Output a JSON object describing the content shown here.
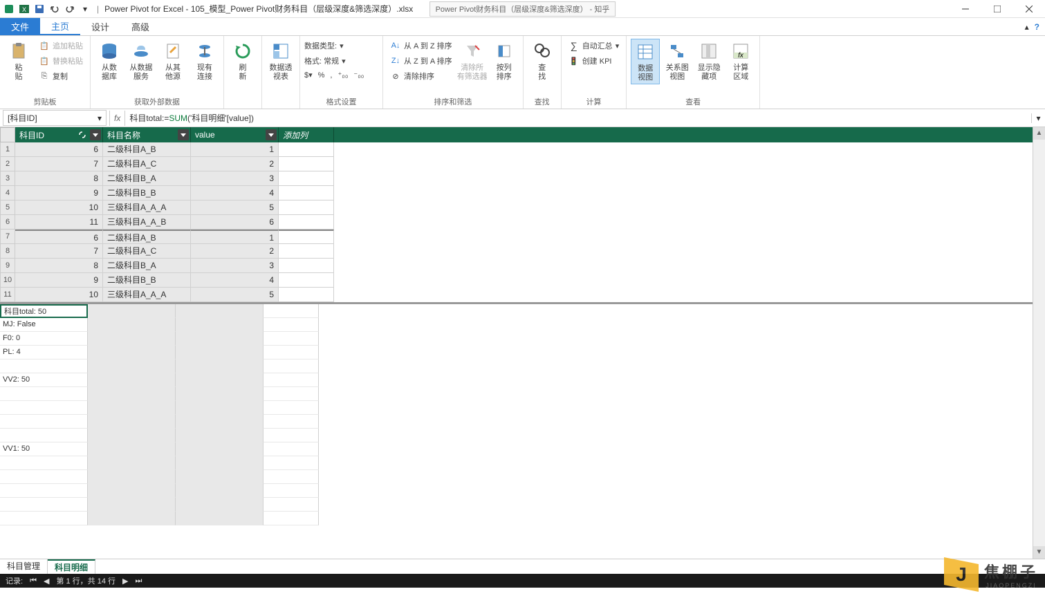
{
  "titlebar": {
    "app_title": "Power Pivot for Excel - 105_模型_Power Pivot财务科目（层级深度&筛选深度）.xlsx",
    "background_tab": "Power Pivot财务科目（层级深度&筛选深度） - 知乎"
  },
  "ribbon_tabs": {
    "file": "文件",
    "home": "主页",
    "design": "设计",
    "advanced": "高级"
  },
  "ribbon": {
    "clipboard": {
      "paste": "粘\n贴",
      "append_paste": "追加粘贴",
      "replace_paste": "替换粘贴",
      "copy": "复制",
      "group_label": "剪贴板"
    },
    "external_data": {
      "from_db": "从数\n据库",
      "from_service": "从数据\n服务",
      "from_other": "从其\n他源",
      "existing_conn": "现有\n连接",
      "group_label": "获取外部数据"
    },
    "refresh": {
      "refresh": "刷\n新"
    },
    "pivot": {
      "pivot_table": "数据透\n视表"
    },
    "format": {
      "data_type": "数据类型:",
      "format": "格式: 常规",
      "group_label": "格式设置"
    },
    "sort": {
      "sort_az": "从 A 到 Z 排序",
      "sort_za": "从 Z 到 A 排序",
      "clear_sort": "清除排序",
      "clear_filter": "清除所\n有筛选器",
      "sort_by_col": "按列\n排序",
      "group_label": "排序和筛选"
    },
    "find": {
      "find": "查\n找",
      "group_label": "查找"
    },
    "calc": {
      "autosum": "自动汇总",
      "create_kpi": "创建 KPI",
      "group_label": "计算"
    },
    "view": {
      "data_view": "数据\n视图",
      "diagram_view": "关系图\n视图",
      "show_hidden": "显示隐\n藏项",
      "calc_area": "计算\n区域",
      "group_label": "查看"
    }
  },
  "formula_bar": {
    "name_box": "[科目ID]",
    "formula_prefix": "科目total:=",
    "formula_fn": "SUM",
    "formula_args": "('科目明细'[value])"
  },
  "columns": {
    "id": "科目ID",
    "name": "科目名称",
    "value": "value",
    "add": "添加列"
  },
  "rows": [
    {
      "n": "1",
      "id": "6",
      "name": "二级科目A_B",
      "value": "1"
    },
    {
      "n": "2",
      "id": "7",
      "name": "二级科目A_C",
      "value": "2"
    },
    {
      "n": "3",
      "id": "8",
      "name": "二级科目B_A",
      "value": "3"
    },
    {
      "n": "4",
      "id": "9",
      "name": "二级科目B_B",
      "value": "4"
    },
    {
      "n": "5",
      "id": "10",
      "name": "三级科目A_A_A",
      "value": "5"
    },
    {
      "n": "6",
      "id": "11",
      "name": "三级科目A_A_B",
      "value": "6"
    },
    {
      "n": "7",
      "id": "6",
      "name": "二级科目A_B",
      "value": "1"
    },
    {
      "n": "8",
      "id": "7",
      "name": "二级科目A_C",
      "value": "2"
    },
    {
      "n": "9",
      "id": "8",
      "name": "二级科目B_A",
      "value": "3"
    },
    {
      "n": "10",
      "id": "9",
      "name": "二级科目B_B",
      "value": "4"
    },
    {
      "n": "11",
      "id": "10",
      "name": "三级科目A_A_A",
      "value": "5"
    }
  ],
  "measures": [
    "科目total: 50",
    "MJ: False",
    "F0: 0",
    "PL: 4",
    "",
    "VV2: 50",
    "",
    "",
    "",
    "",
    "VV1: 50"
  ],
  "sheets": {
    "tab1": "科目管理",
    "tab2": "科目明细"
  },
  "status": {
    "record_label": "记录:",
    "position": "第 1 行，共 14 行"
  },
  "watermark": {
    "cn": "焦棚子",
    "en": "JIAOPENGZI"
  }
}
